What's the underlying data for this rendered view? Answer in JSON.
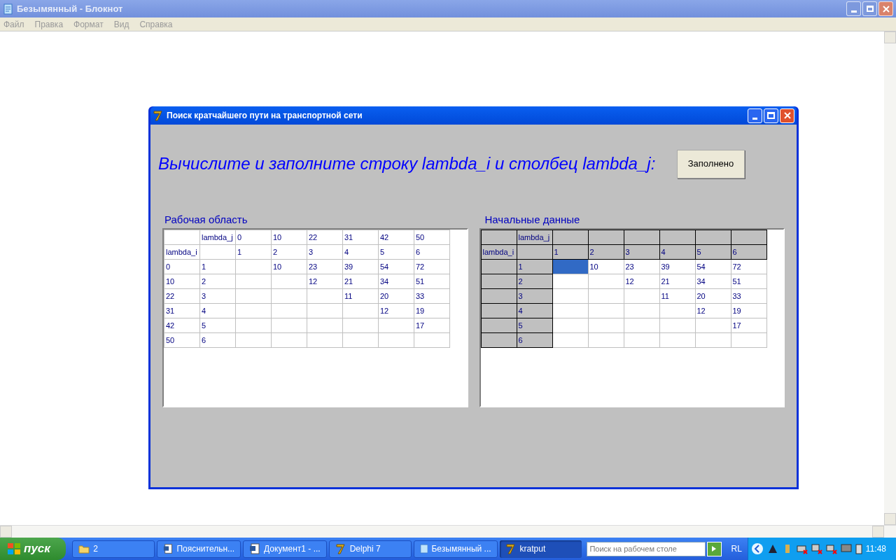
{
  "notepad": {
    "title": "Безымянный - Блокнот",
    "menu": [
      "Файл",
      "Правка",
      "Формат",
      "Вид",
      "Справка"
    ]
  },
  "dialog": {
    "title": "Поиск кратчайшего пути на транспортной сети",
    "prompt": "Вычислите и заполните строку lambda_i и столбец lambda_j:",
    "button": "Заполнено"
  },
  "work_area": {
    "label": "Рабочая область",
    "rows": [
      [
        null,
        "lambda_j",
        "0",
        "10",
        "22",
        "31",
        "42",
        "50"
      ],
      [
        "lambda_i",
        null,
        "1",
        "2",
        "3",
        "4",
        "5",
        "6"
      ],
      [
        "0",
        "1",
        null,
        "10",
        "23",
        "39",
        "54",
        "72"
      ],
      [
        "10",
        "2",
        null,
        null,
        "12",
        "21",
        "34",
        "51"
      ],
      [
        "22",
        "3",
        null,
        null,
        null,
        "11",
        "20",
        "33"
      ],
      [
        "31",
        "4",
        null,
        null,
        null,
        null,
        "12",
        "19"
      ],
      [
        "42",
        "5",
        null,
        null,
        null,
        null,
        null,
        "17"
      ],
      [
        "50",
        "6",
        null,
        null,
        null,
        null,
        null,
        null
      ]
    ]
  },
  "source_data": {
    "label": "Начальные данные",
    "header_rows": [
      [
        null,
        "lambda_j",
        null,
        null,
        null,
        null,
        null,
        null
      ],
      [
        "lambda_i",
        null,
        "1",
        "2",
        "3",
        "4",
        "5",
        "6"
      ]
    ],
    "body_rows": [
      {
        "row_header": "1",
        "cells": [
          {
            "selected": true
          },
          {
            "text": "10",
            "selected": false
          },
          {
            "text": "23",
            "selected": false
          },
          {
            "text": "39",
            "selected": false
          },
          {
            "text": "54",
            "selected": false
          },
          {
            "text": "72",
            "selected": false
          }
        ]
      },
      {
        "row_header": "2",
        "cells": [
          {
            "selected": false
          },
          {
            "selected": false
          },
          {
            "text": "12",
            "selected": false
          },
          {
            "text": "21",
            "selected": false
          },
          {
            "text": "34",
            "selected": false
          },
          {
            "text": "51",
            "selected": false
          }
        ]
      },
      {
        "row_header": "3",
        "cells": [
          {
            "selected": false
          },
          {
            "selected": false
          },
          {
            "selected": false
          },
          {
            "text": "11",
            "selected": false
          },
          {
            "text": "20",
            "selected": false
          },
          {
            "text": "33",
            "selected": false
          }
        ]
      },
      {
        "row_header": "4",
        "cells": [
          {
            "selected": false
          },
          {
            "selected": false
          },
          {
            "selected": false
          },
          {
            "selected": false
          },
          {
            "text": "12",
            "selected": false
          },
          {
            "text": "19",
            "selected": false
          }
        ]
      },
      {
        "row_header": "5",
        "cells": [
          {
            "selected": false
          },
          {
            "selected": false
          },
          {
            "selected": false
          },
          {
            "selected": false
          },
          {
            "selected": false
          },
          {
            "text": "17",
            "selected": false
          }
        ]
      },
      {
        "row_header": "6",
        "cells": [
          {
            "selected": false
          },
          {
            "selected": false
          },
          {
            "selected": false
          },
          {
            "selected": false
          },
          {
            "selected": false
          },
          {
            "selected": false
          }
        ]
      }
    ]
  },
  "taskbar": {
    "start": "пуск",
    "items": [
      {
        "label": "2",
        "kind": "folder",
        "selected": false
      },
      {
        "label": "Пояснительн...",
        "kind": "word",
        "selected": false
      },
      {
        "label": "Документ1 - ...",
        "kind": "word",
        "selected": false
      },
      {
        "label": "Delphi 7",
        "kind": "delphi",
        "selected": false
      },
      {
        "label": "Безымянный ...",
        "kind": "notepad",
        "selected": false
      },
      {
        "label": "kratput",
        "kind": "delphi",
        "selected": true
      }
    ],
    "search": {
      "placeholder": "Поиск на рабочем столе"
    },
    "language": "RL",
    "time": "11:48"
  }
}
